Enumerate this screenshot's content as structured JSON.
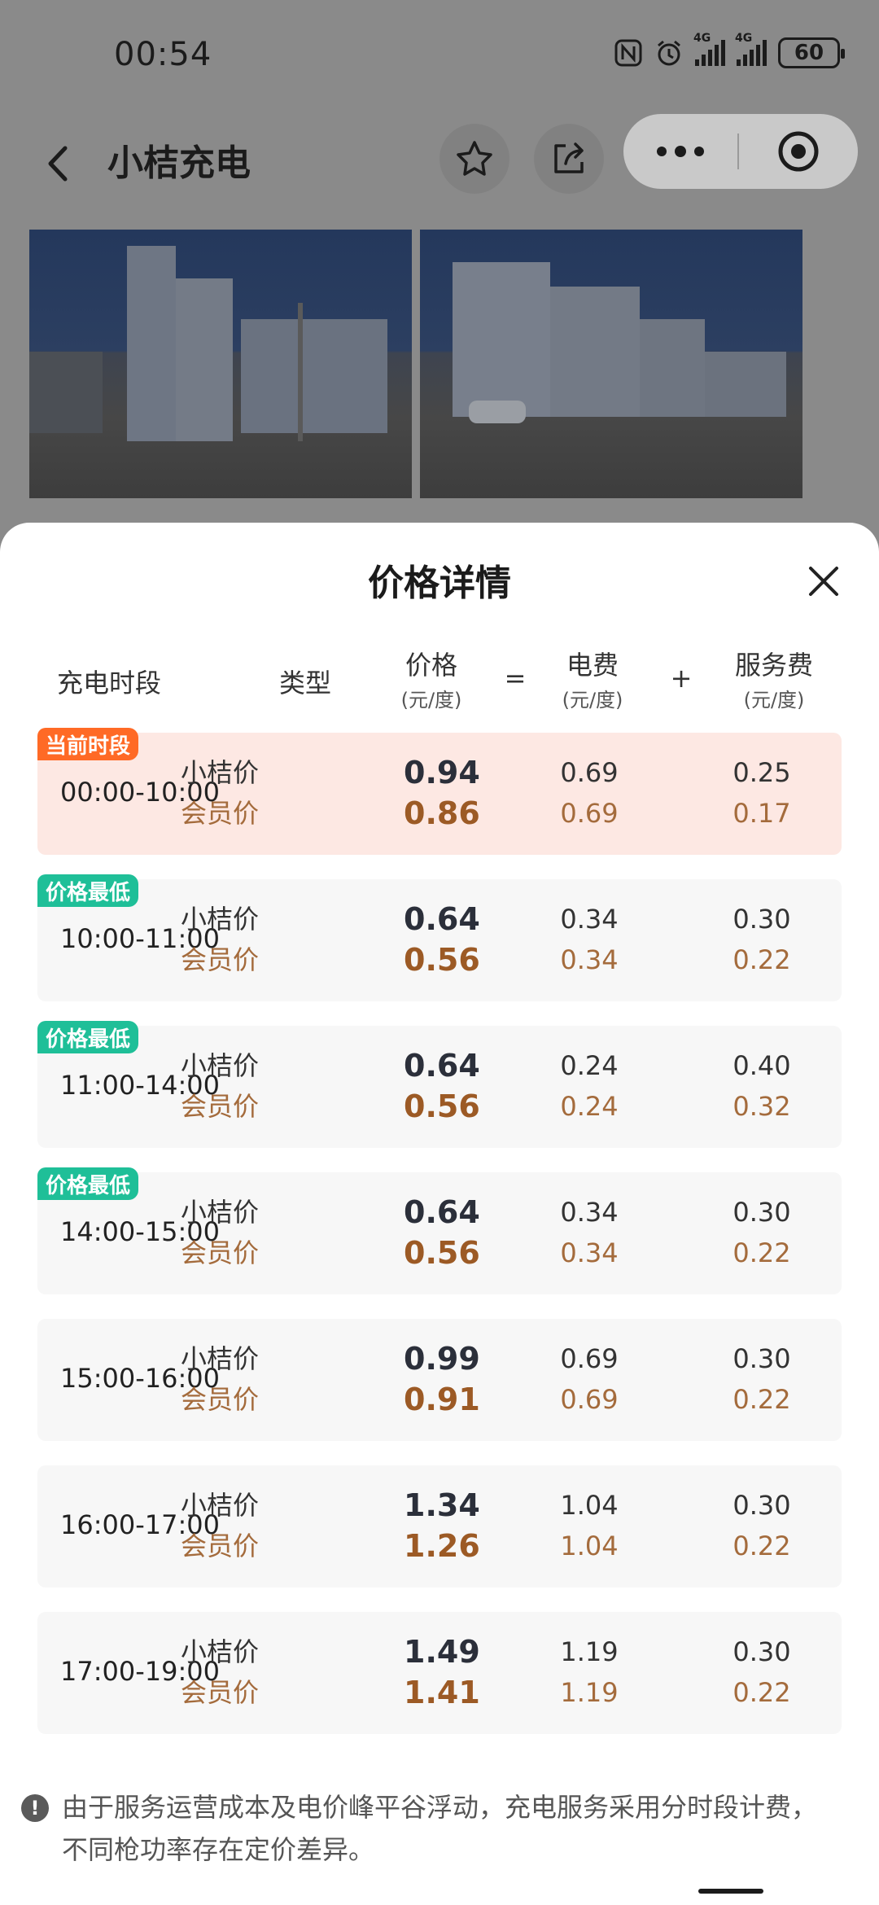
{
  "status_bar": {
    "time": "00:54",
    "battery": "60",
    "net1": "4G",
    "net2": "4G"
  },
  "nav": {
    "title": "小桔充电"
  },
  "sheet": {
    "title": "价格详情",
    "headers": {
      "period": "充电时段",
      "type": "类型",
      "price": "价格",
      "price_unit": "(元/度)",
      "eq": "=",
      "elec": "电费",
      "elec_unit": "(元/度)",
      "plus": "+",
      "service": "服务费",
      "service_unit": "(元/度)"
    },
    "rows": [
      {
        "badge": "当前时段",
        "period": "00:00-10:00",
        "type1": "小桔价",
        "type2": "会员价",
        "price1": "0.94",
        "price2": "0.86",
        "elec1": "0.69",
        "elec2": "0.69",
        "svc1": "0.25",
        "svc2": "0.17"
      },
      {
        "badge": "价格最低",
        "period": "10:00-11:00",
        "type1": "小桔价",
        "type2": "会员价",
        "price1": "0.64",
        "price2": "0.56",
        "elec1": "0.34",
        "elec2": "0.34",
        "svc1": "0.30",
        "svc2": "0.22"
      },
      {
        "badge": "价格最低",
        "period": "11:00-14:00",
        "type1": "小桔价",
        "type2": "会员价",
        "price1": "0.64",
        "price2": "0.56",
        "elec1": "0.24",
        "elec2": "0.24",
        "svc1": "0.40",
        "svc2": "0.32"
      },
      {
        "badge": "价格最低",
        "period": "14:00-15:00",
        "type1": "小桔价",
        "type2": "会员价",
        "price1": "0.64",
        "price2": "0.56",
        "elec1": "0.34",
        "elec2": "0.34",
        "svc1": "0.30",
        "svc2": "0.22"
      },
      {
        "period": "15:00-16:00",
        "type1": "小桔价",
        "type2": "会员价",
        "price1": "0.99",
        "price2": "0.91",
        "elec1": "0.69",
        "elec2": "0.69",
        "svc1": "0.30",
        "svc2": "0.22"
      },
      {
        "period": "16:00-17:00",
        "type1": "小桔价",
        "type2": "会员价",
        "price1": "1.34",
        "price2": "1.26",
        "elec1": "1.04",
        "elec2": "1.04",
        "svc1": "0.30",
        "svc2": "0.22"
      },
      {
        "period": "17:00-19:00",
        "type1": "小桔价",
        "type2": "会员价",
        "price1": "1.49",
        "price2": "1.41",
        "elec1": "1.19",
        "elec2": "1.19",
        "svc1": "0.30",
        "svc2": "0.22"
      }
    ],
    "footer_note": "由于服务运营成本及电价峰平谷浮动，充电服务采用分时段计费，不同枪功率存在定价差异。"
  },
  "colors": {
    "current_bg": "#fde8e3",
    "badge_current": "#ff6a26",
    "badge_lowest": "#1fbf98",
    "member_price": "#9c5a25"
  }
}
